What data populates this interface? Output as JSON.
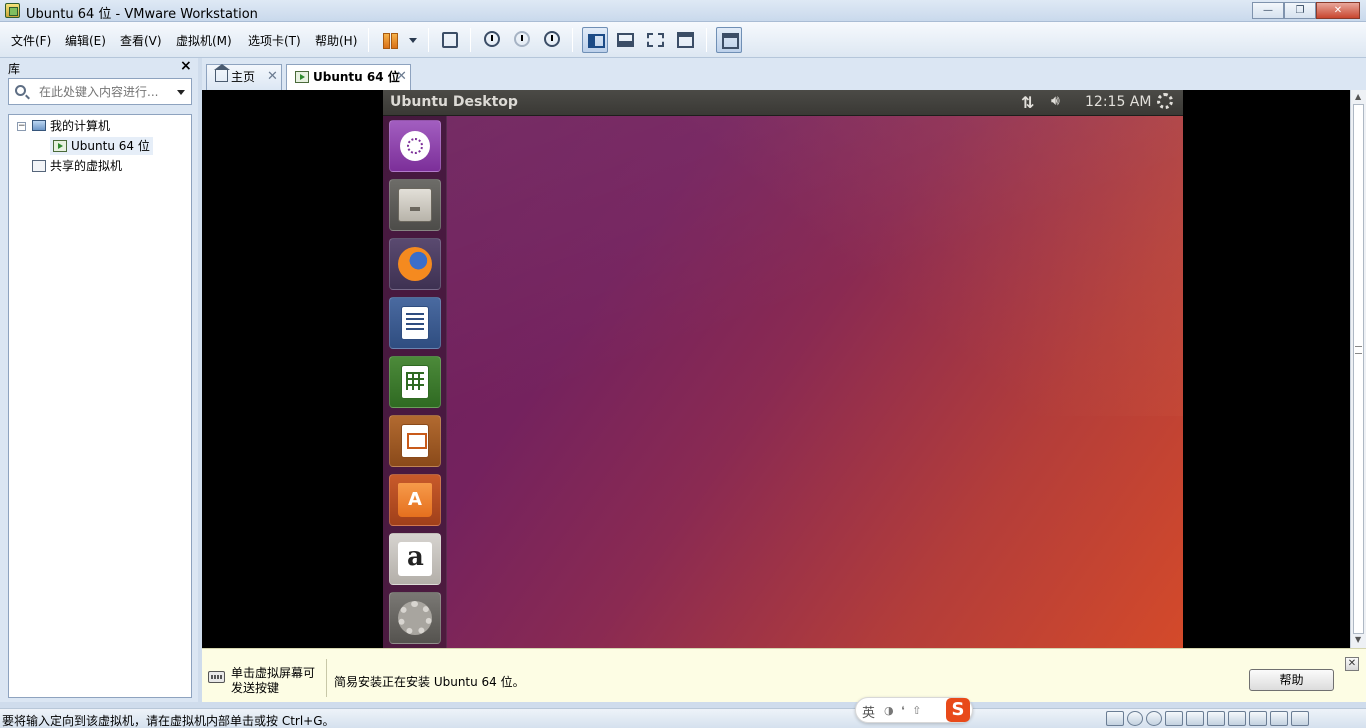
{
  "window": {
    "title": "Ubuntu 64 位 - VMware Workstation"
  },
  "menu": [
    {
      "label": "文件(F)"
    },
    {
      "label": "编辑(E)"
    },
    {
      "label": "查看(V)"
    },
    {
      "label": "虚拟机(M)"
    },
    {
      "label": "选项卡(T)"
    },
    {
      "label": "帮助(H)"
    }
  ],
  "library": {
    "title": "库",
    "search_placeholder": "在此处键入内容进行...",
    "tree": {
      "my_computer": "我的计算机",
      "vm": "Ubuntu 64 位",
      "shared": "共享的虚拟机"
    }
  },
  "tabs": [
    {
      "label": "主页"
    },
    {
      "label": "Ubuntu 64 位"
    }
  ],
  "guest": {
    "window_title": "Ubuntu Desktop",
    "clock": "12:15 AM",
    "launcher": [
      {
        "icon": "ubuntu-dash-icon"
      },
      {
        "icon": "files-icon"
      },
      {
        "icon": "firefox-icon"
      },
      {
        "icon": "libreoffice-writer-icon"
      },
      {
        "icon": "libreoffice-calc-icon"
      },
      {
        "icon": "libreoffice-impress-icon"
      },
      {
        "icon": "software-center-icon"
      },
      {
        "icon": "amazon-icon"
      },
      {
        "icon": "system-settings-icon"
      }
    ]
  },
  "hint": {
    "click_hint": "单击虚拟屏幕可发送按键",
    "message": "简易安装正在安装 Ubuntu 64 位。",
    "help_button": "帮助"
  },
  "status": {
    "text": "要将输入定向到该虚拟机，请在虚拟机内部单击或按 Ctrl+G。"
  },
  "ime": {
    "lang": "英"
  },
  "colors": {
    "accent": "#1c4b86",
    "ubuntu_orange": "#d44a2a",
    "ubuntu_purple": "#6a1e5a",
    "hint_background": "#fdfde4"
  }
}
